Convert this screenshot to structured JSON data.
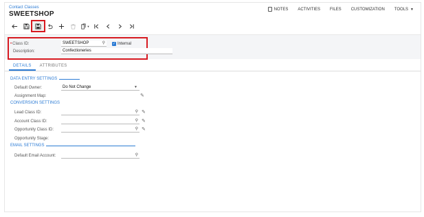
{
  "breadcrumb": "Contact Classes",
  "title": "SWEETSHOP",
  "topmenu": {
    "notes": "NOTES",
    "activities": "ACTIVITIES",
    "files": "FILES",
    "customization": "CUSTOMIZATION",
    "tools": "TOOLS"
  },
  "toolbar": {
    "back_icon": "arrow-left",
    "save_icon": "save",
    "save_close_icon": "save-and-close",
    "undo_icon": "undo",
    "add_icon": "plus",
    "delete_icon": "trash",
    "copy_icon": "copy-paste",
    "first_icon": "first-record",
    "prev_icon": "previous",
    "next_icon": "next",
    "last_icon": "last-record"
  },
  "form": {
    "class_id_label": "Class ID:",
    "class_id_value": "SWEETSHOP",
    "internal_label": "Internal",
    "description_label": "Description:",
    "description_value": "Confectioneries"
  },
  "tabs": [
    "DETAILS",
    "ATTRIBUTES"
  ],
  "sections": {
    "data_entry": "DATA ENTRY SETTINGS",
    "conversion": "CONVERSION SETTINGS",
    "email": "EMAIL SETTINGS"
  },
  "fields": {
    "default_owner_label": "Default Owner:",
    "default_owner_value": "Do Not Change",
    "assignment_map_label": "Assignment Map:",
    "lead_class_label": "Lead Class ID:",
    "account_class_label": "Account Class ID:",
    "opportunity_class_label": "Opportunity Class ID:",
    "opportunity_stage_label": "Opportunity Stage:",
    "default_email_label": "Default Email Account:"
  },
  "colors": {
    "accent": "#2b7bd4",
    "highlight": "#d71920"
  }
}
